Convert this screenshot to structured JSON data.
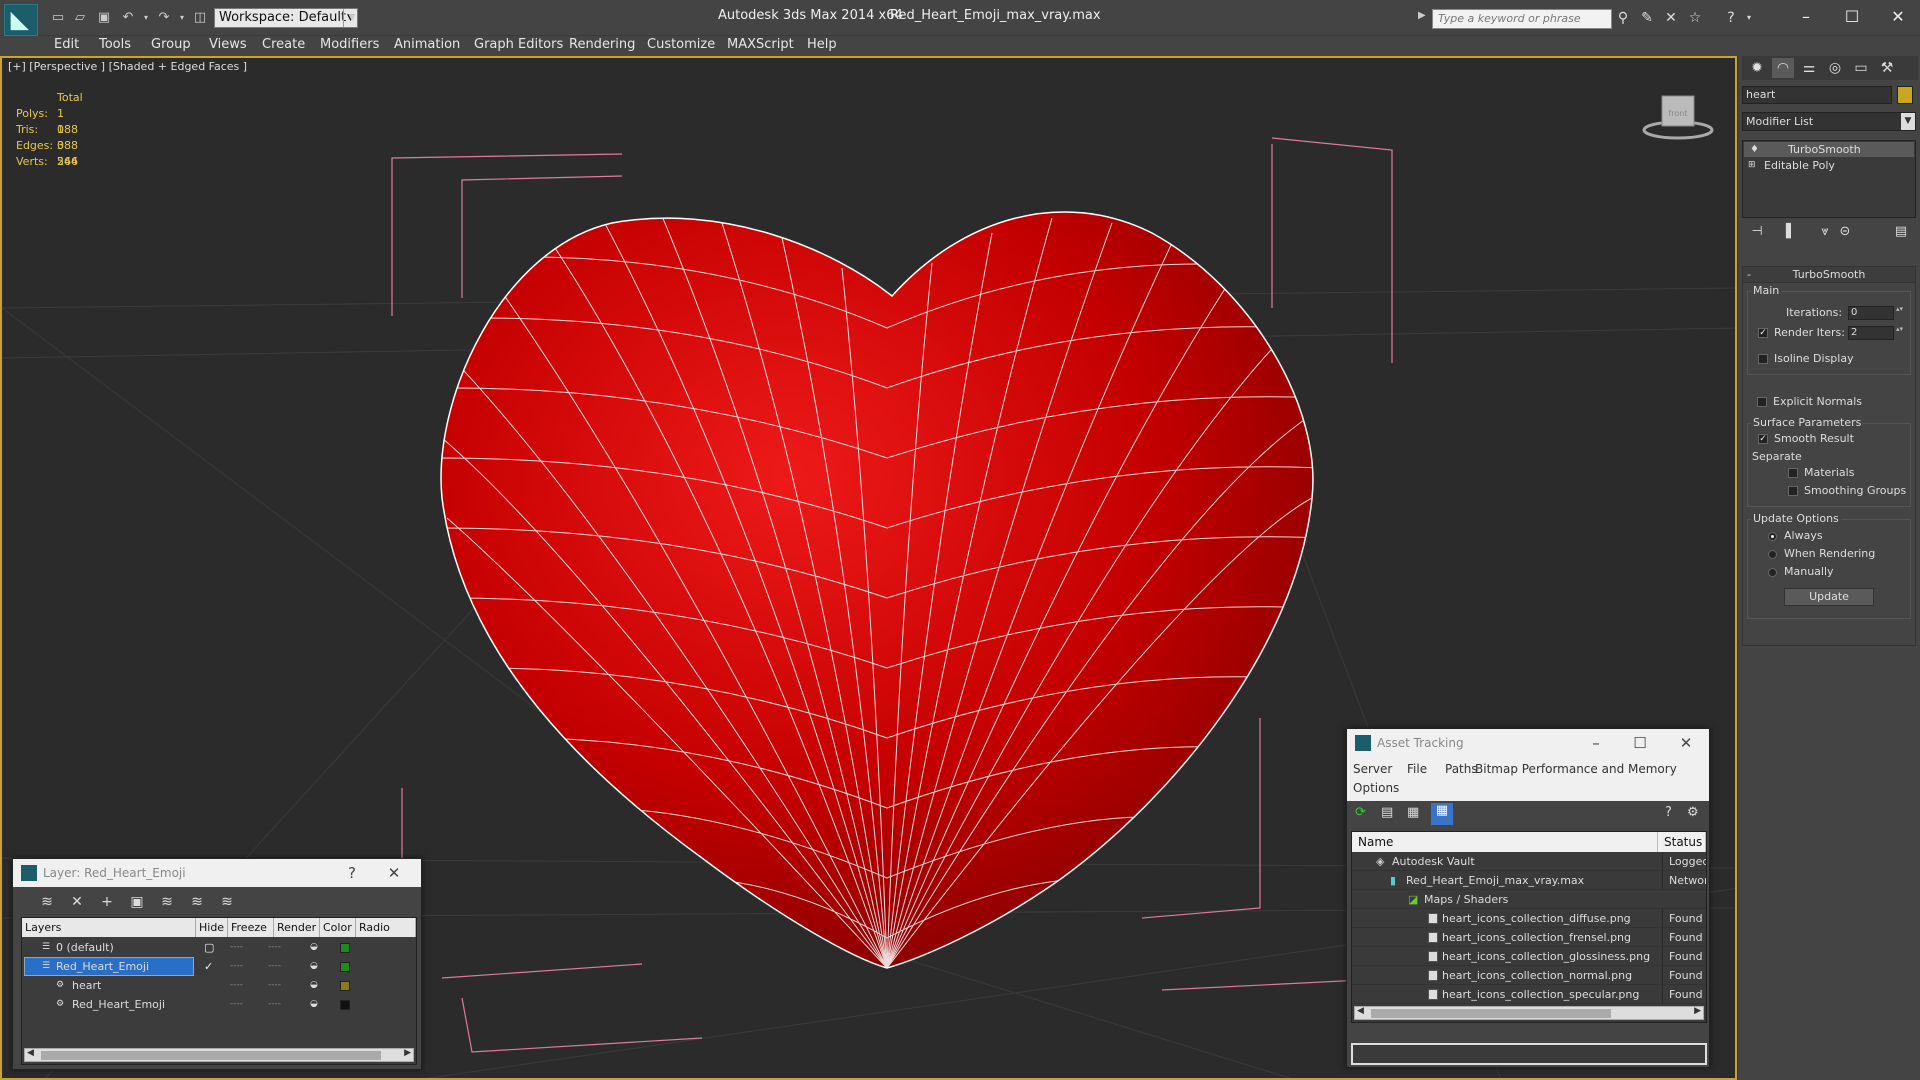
{
  "app": {
    "title": "Autodesk 3ds Max  2014 x64",
    "file": "Red_Heart_Emoji_max_vray.max",
    "workspace": "Workspace: Default",
    "search_placeholder": "Type a keyword or phrase"
  },
  "menu": [
    "Edit",
    "Tools",
    "Group",
    "Views",
    "Create",
    "Modifiers",
    "Animation",
    "Graph Editors",
    "Rendering",
    "Customize",
    "MAXScript",
    "Help"
  ],
  "viewport": {
    "label": "[+] [Perspective ] [Shaded + Edged Faces ]",
    "stats": {
      "header": "Total",
      "rows": [
        {
          "k": "Polys:",
          "v": "1 088"
        },
        {
          "k": "Tris:",
          "v": "1 088"
        },
        {
          "k": "Edges:",
          "v": "3 264"
        },
        {
          "k": "Verts:",
          "v": "546"
        }
      ]
    },
    "viewcube_label": "front"
  },
  "command_panel": {
    "object_name": "heart",
    "object_color": "#c8a81e",
    "modifier_list": "Modifier List",
    "stack": [
      "TurboSmooth",
      "Editable Poly"
    ],
    "rollout_title": "TurboSmooth",
    "main_label": "Main",
    "iterations_label": "Iterations:",
    "iterations_value": "0",
    "render_iters_label": "Render Iters:",
    "render_iters_value": "2",
    "isoline": "Isoline Display",
    "explicit": "Explicit Normals",
    "surface_params": "Surface Parameters",
    "smooth_result": "Smooth Result",
    "separate": "Separate",
    "materials": "Materials",
    "smoothing_groups": "Smoothing Groups",
    "update_options": "Update Options",
    "always": "Always",
    "when_rendering": "When Rendering",
    "manually": "Manually",
    "update_btn": "Update"
  },
  "layer_window": {
    "title": "Layer: Red_Heart_Emoji",
    "help": "?",
    "columns": [
      "Layers",
      "Hide",
      "Freeze",
      "Render",
      "Color",
      "Radio"
    ],
    "rows": [
      {
        "name": "0 (default)",
        "color": "#1e8a1e"
      },
      {
        "name": "Red_Heart_Emoji",
        "color": "#1e8a1e",
        "selected": true
      },
      {
        "name": "heart",
        "color": "#8a7a1e"
      },
      {
        "name": "Red_Heart_Emoji",
        "color": "#111111"
      }
    ]
  },
  "asset_window": {
    "title": "Asset Tracking",
    "menu": [
      "Server",
      "File",
      "Paths",
      "Bitmap Performance and Memory",
      "Options"
    ],
    "columns": [
      "Name",
      "Status"
    ],
    "rows": [
      {
        "name": "Autodesk Vault",
        "status": "Logged"
      },
      {
        "name": "Red_Heart_Emoji_max_vray.max",
        "status": "Networ"
      },
      {
        "name": "Maps / Shaders",
        "status": ""
      },
      {
        "name": "heart_icons_collection_diffuse.png",
        "status": "Found"
      },
      {
        "name": "heart_icons_collection_frensel.png",
        "status": "Found"
      },
      {
        "name": "heart_icons_collection_glossiness.png",
        "status": "Found"
      },
      {
        "name": "heart_icons_collection_normal.png",
        "status": "Found"
      },
      {
        "name": "heart_icons_collection_specular.png",
        "status": "Found"
      }
    ]
  },
  "colors": {
    "viewport_border": "#c9a32c",
    "heart": "#cc0000",
    "bbox": "#e07aa0"
  }
}
